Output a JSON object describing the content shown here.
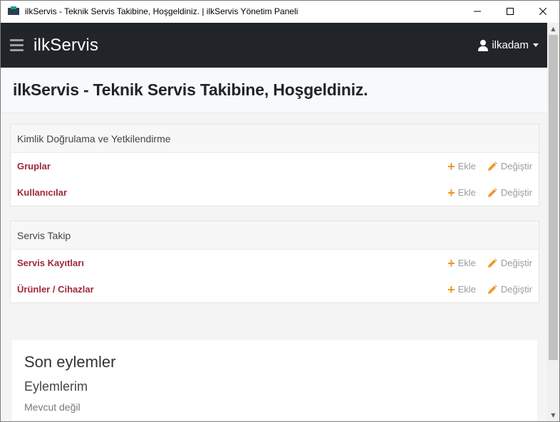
{
  "window": {
    "title": "ilkServis - Teknik Servis Takibine, Hoşgeldiniz. | ilkServis Yönetim Paneli",
    "controls": {
      "minimize": "—",
      "maximize": "☐",
      "close": "✕"
    }
  },
  "navbar": {
    "brand": "ilkServis",
    "user": "ilkadam"
  },
  "header": {
    "title": "ilkServis - Teknik Servis Takibine, Hoşgeldiniz."
  },
  "modules": [
    {
      "title": "Kimlik Doğrulama ve Yetkilendirme",
      "rows": [
        {
          "name": "Gruplar",
          "add": "Ekle",
          "change": "Değiştir"
        },
        {
          "name": "Kullanıcılar",
          "add": "Ekle",
          "change": "Değiştir"
        }
      ]
    },
    {
      "title": "Servis Takip",
      "rows": [
        {
          "name": "Servis Kayıtları",
          "add": "Ekle",
          "change": "Değiştir"
        },
        {
          "name": "Ürünler / Cihazlar",
          "add": "Ekle",
          "change": "Değiştir"
        }
      ]
    }
  ],
  "recent": {
    "title": "Son eylemler",
    "subtitle": "Eylemlerim",
    "empty": "Mevcut değil"
  },
  "colors": {
    "navbar": "#212529",
    "link": "#a0283a",
    "action_icon": "#f0962a"
  }
}
